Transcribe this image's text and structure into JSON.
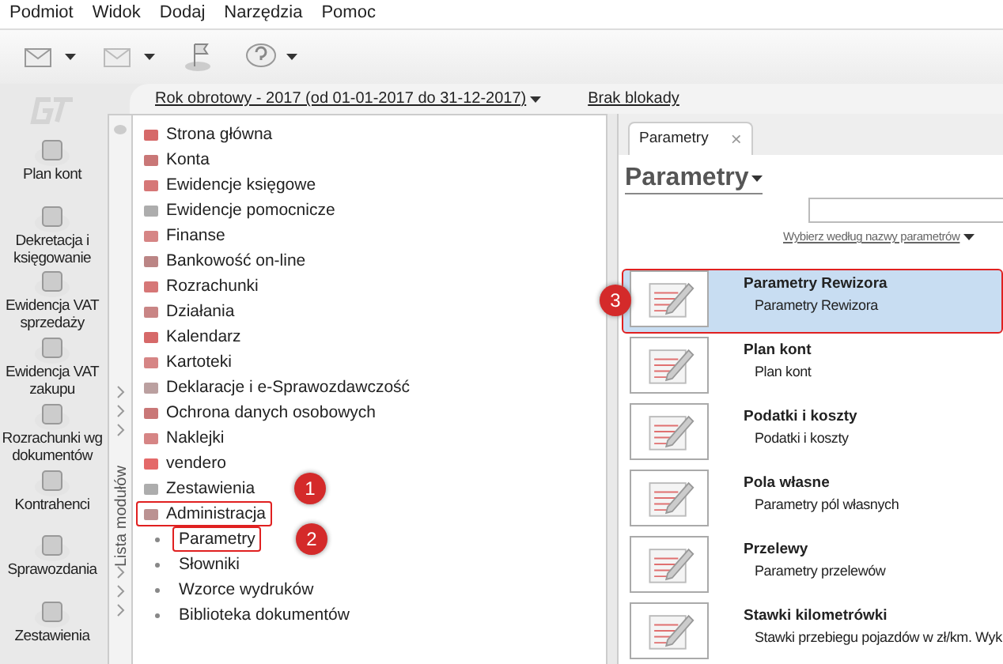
{
  "menu": [
    "Podmiot",
    "Widok",
    "Dodaj",
    "Narzędzia",
    "Pomoc"
  ],
  "fiscal_bar": {
    "year": "Rok obrotowy - 2017  (od 01-01-2017 do 31-12-2017)",
    "lock": "Brak blokady"
  },
  "left_nav": [
    {
      "label": "Plan kont"
    },
    {
      "label": "Dekretacja i księgowanie"
    },
    {
      "label": "Ewidencja VAT sprzedaży"
    },
    {
      "label": "Ewidencja VAT zakupu"
    },
    {
      "label": "Rozrachunki wg dokumentów"
    },
    {
      "label": "Kontrahenci"
    },
    {
      "label": "Sprawozdania"
    },
    {
      "label": "Zestawienia"
    }
  ],
  "module_panel": {
    "title": "Lista modułów",
    "items": [
      {
        "label": "Strona główna",
        "highlighted": false
      },
      {
        "label": "Konta",
        "highlighted": false
      },
      {
        "label": "Ewidencje księgowe",
        "highlighted": false
      },
      {
        "label": "Ewidencje pomocnicze",
        "highlighted": false
      },
      {
        "label": "Finanse",
        "highlighted": false
      },
      {
        "label": "Bankowość on-line",
        "highlighted": false
      },
      {
        "label": "Rozrachunki",
        "highlighted": false
      },
      {
        "label": "Działania",
        "highlighted": false
      },
      {
        "label": "Kalendarz",
        "highlighted": false
      },
      {
        "label": "Kartoteki",
        "highlighted": false
      },
      {
        "label": "Deklaracje i e-Sprawozdawczość",
        "highlighted": false
      },
      {
        "label": "Ochrona danych osobowych",
        "highlighted": false
      },
      {
        "label": "Naklejki",
        "highlighted": false
      },
      {
        "label": "vendero",
        "highlighted": false
      },
      {
        "label": "Zestawienia",
        "highlighted": false
      },
      {
        "label": "Administracja",
        "highlighted": true,
        "callout": "1",
        "children": [
          {
            "label": "Parametry",
            "highlighted": true,
            "callout": "2"
          },
          {
            "label": "Słowniki",
            "highlighted": false
          },
          {
            "label": "Wzorce wydruków",
            "highlighted": false
          },
          {
            "label": "Biblioteka dokumentów",
            "highlighted": false
          }
        ]
      }
    ]
  },
  "tab": {
    "label": "Parametry",
    "close": "×"
  },
  "content": {
    "title": "Parametry",
    "filter": "Wybierz według nazwy parametrów",
    "rows": [
      {
        "title": "Parametry Rewizora",
        "subtitle": "Parametry Rewizora",
        "selected": true,
        "highlighted": true,
        "callout": "3"
      },
      {
        "title": "Plan kont",
        "subtitle": "Plan kont",
        "selected": false,
        "highlighted": false
      },
      {
        "title": "Podatki i koszty",
        "subtitle": "Podatki i koszty",
        "selected": false,
        "highlighted": false
      },
      {
        "title": "Pola własne",
        "subtitle": "Parametry pól własnych",
        "selected": false,
        "highlighted": false
      },
      {
        "title": "Przelewy",
        "subtitle": "Parametry przelewów",
        "selected": false,
        "highlighted": false
      },
      {
        "title": "Stawki kilometrówki",
        "subtitle": "Stawki przebiegu pojazdów w zł/km. Wyk",
        "selected": false,
        "highlighted": false
      }
    ]
  }
}
